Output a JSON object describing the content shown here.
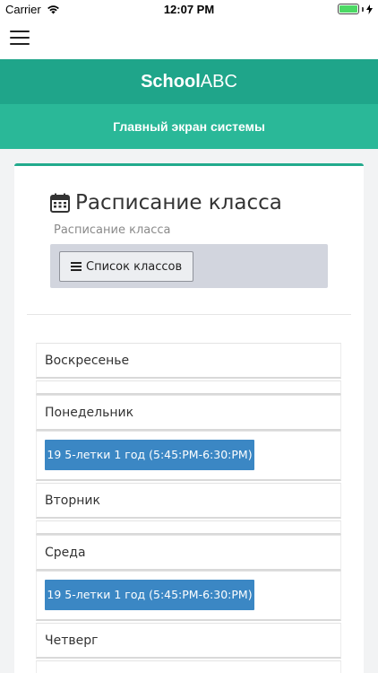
{
  "status_bar": {
    "carrier": "Carrier",
    "time": "12:07 PM",
    "battery_level": 1.0
  },
  "header": {
    "menu_icon": "hamburger-icon",
    "brand_bold": "School",
    "brand_light": "ABC",
    "subtitle": "Главный экран системы"
  },
  "schedule": {
    "title": "Расписание класса",
    "subtitle": "Расписание класса",
    "title_icon": "calendar-icon",
    "list_button_label": "Список классов",
    "list_button_icon": "bars-icon",
    "days": [
      {
        "label": "Воскресенье",
        "events": []
      },
      {
        "label": "Понедельник",
        "events": [
          "19 5-летки 1 год (5:45:PM-6:30:PM)"
        ]
      },
      {
        "label": "Вторник",
        "events": []
      },
      {
        "label": "Среда",
        "events": [
          "19 5-летки 1 год (5:45:PM-6:30:PM)"
        ]
      },
      {
        "label": "Четверг",
        "events": []
      }
    ]
  },
  "colors": {
    "brand_primary": "#1fa58a",
    "brand_secondary": "#2ab898",
    "event_blue": "#3b87c4",
    "toolbar_gray": "#d2d5de"
  }
}
